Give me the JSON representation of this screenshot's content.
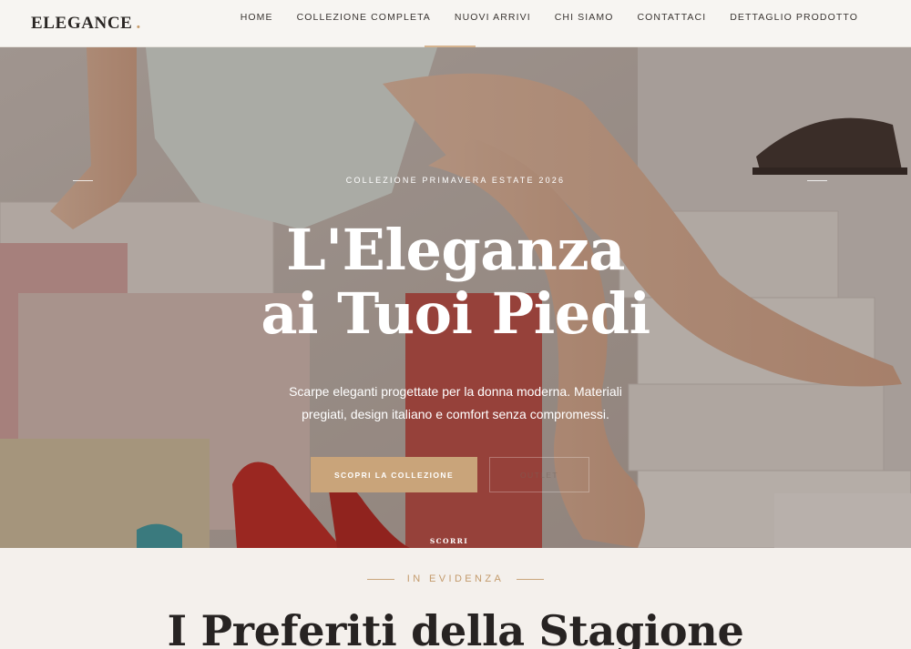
{
  "header": {
    "logo": "ELEGANCE",
    "logo_dot": ".",
    "nav": [
      "HOME",
      "COLLEZIONE COMPLETA",
      "NUOVI ARRIVI",
      "CHI SIAMO",
      "CONTATTACI",
      "DETTAGLIO PRODOTTO"
    ]
  },
  "hero": {
    "eyebrow": "COLLEZIONE PRIMAVERA ESTATE 2026",
    "title_line1": "L'Eleganza",
    "title_line2": "ai Tuoi Piedi",
    "subtitle_line1": "Scarpe eleganti progettate per la donna moderna. Materiali",
    "subtitle_line2": "pregiati, design italiano e comfort senza compromessi.",
    "primary_cta": "SCOPRI LA COLLEZIONE",
    "secondary_cta": "OUTLET",
    "scroll_label": "SCORRI"
  },
  "featured": {
    "eyebrow": "IN EVIDENZA",
    "title": "I Preferiti della Stagione"
  },
  "colors": {
    "accent": "#c9a47a",
    "dark_text": "#2a2624",
    "background": "#f4f0ec"
  }
}
